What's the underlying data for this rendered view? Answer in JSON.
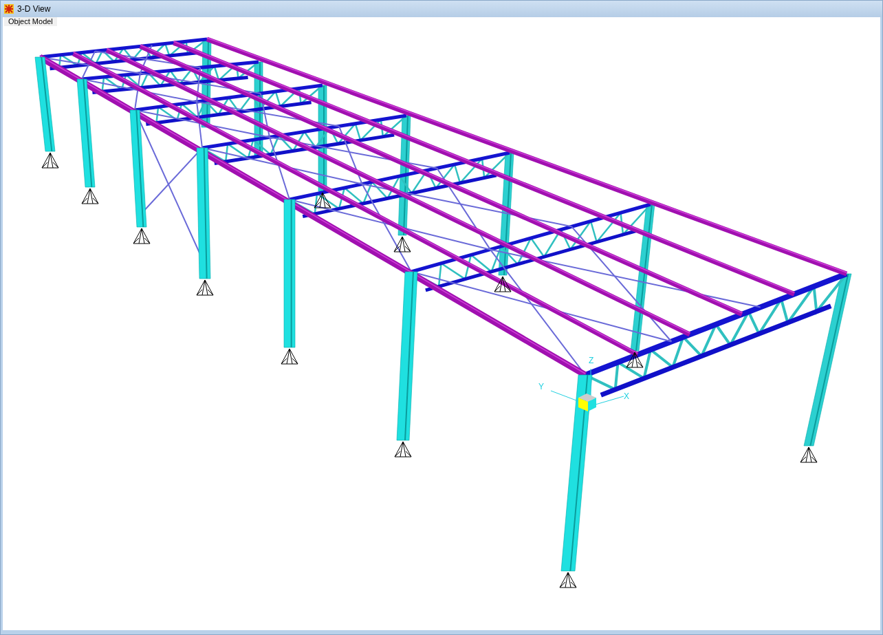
{
  "window": {
    "title": "3-D View"
  },
  "tab": {
    "label": "Object Model"
  },
  "axes": [
    {
      "label": "X"
    },
    {
      "label": "Y"
    },
    {
      "label": "Z"
    }
  ]
}
